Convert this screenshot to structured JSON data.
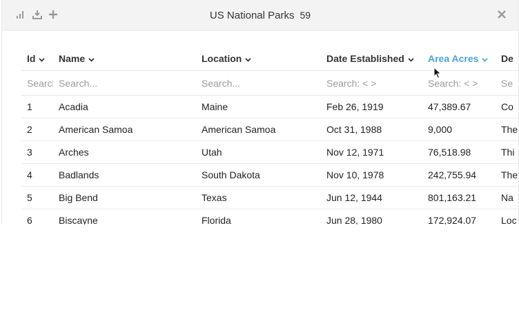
{
  "toolbar": {
    "icons": [
      "bar-chart-icon",
      "download-icon",
      "plus-icon",
      "close-icon"
    ]
  },
  "header": {
    "title": "US National Parks",
    "count": "59"
  },
  "columns": [
    {
      "label": "Id",
      "placeholder": "Search..."
    },
    {
      "label": "Name",
      "placeholder": "Search..."
    },
    {
      "label": "Location",
      "placeholder": "Search..."
    },
    {
      "label": "Date Established",
      "placeholder": "Search: < >"
    },
    {
      "label": "Area Acres",
      "placeholder": "Search: < >"
    },
    {
      "label": "De",
      "placeholder": "Se"
    }
  ],
  "rows": [
    {
      "id": "1",
      "name": "Acadia",
      "location": "Maine",
      "date": "Feb 26, 1919",
      "area": "47,389.67",
      "desc": "Co"
    },
    {
      "id": "2",
      "name": "American Samoa",
      "location": "American Samoa",
      "date": "Oct 31, 1988",
      "area": "9,000",
      "desc": "The"
    },
    {
      "id": "3",
      "name": "Arches",
      "location": "Utah",
      "date": "Nov 12, 1971",
      "area": "76,518.98",
      "desc": "Thi"
    },
    {
      "id": "4",
      "name": "Badlands",
      "location": "South Dakota",
      "date": "Nov 10, 1978",
      "area": "242,755.94",
      "desc": "The"
    },
    {
      "id": "5",
      "name": "Big Bend",
      "location": "Texas",
      "date": "Jun 12, 1944",
      "area": "801,163.21",
      "desc": "Na"
    },
    {
      "id": "6",
      "name": "Biscayne",
      "location": "Florida",
      "date": "Jun 28, 1980",
      "area": "172,924.07",
      "desc": "Loc"
    }
  ],
  "colors": {
    "accent": "#4aa3df",
    "titlebar": "#f3f3f3"
  }
}
